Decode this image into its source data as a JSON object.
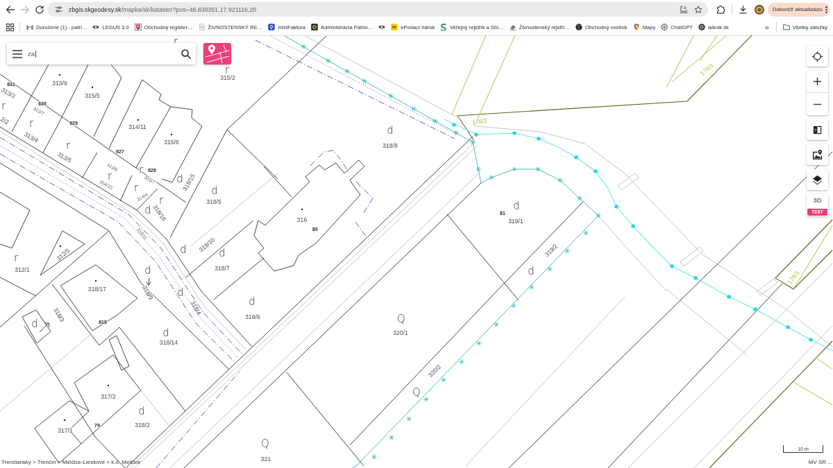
{
  "browser": {
    "navigation": [
      {
        "kind": "back",
        "disabled": false
      },
      {
        "kind": "forward",
        "disabled": true
      },
      {
        "kind": "reload",
        "disabled": false
      }
    ],
    "address": {
      "host": "zbgis.skgeodesy.sk",
      "path": "/mapka/sk/kataster?pos=48.838351,17.921116,20"
    },
    "update_button": "Dokončiť aktualizáciu"
  },
  "bookmarks": {
    "items": [
      {
        "kind": "mail",
        "label": "Doručené (1) - patri…"
      },
      {
        "kind": "eye",
        "label": "LEGUS 3.0"
      },
      {
        "kind": "emblem",
        "label": "Obchodný register…"
      },
      {
        "kind": "document",
        "label": "ŽIVNOSTENSKÝ RE…"
      },
      {
        "kind": "shield",
        "label": "miniFaktúra"
      },
      {
        "kind": "seal",
        "label": "Administrácia Patrio…"
      },
      {
        "kind": "eye"
      },
      {
        "kind": "tile",
        "label": "ePodací hárok"
      },
      {
        "kind": "letter",
        "label": "Veřejný rejstřík a Sbí…"
      },
      {
        "kind": "stamp",
        "label": "Živnostenský rejstří…"
      },
      {
        "kind": "globe",
        "label": "Obchodný vestník"
      },
      {
        "kind": "pin",
        "label": "Mapy"
      },
      {
        "kind": "knot",
        "label": "ChatGPT"
      },
      {
        "kind": "badge",
        "label": "advok.sk"
      }
    ],
    "overflow": "»",
    "all": "Všetky záložky"
  },
  "map": {
    "search": {
      "value": "za"
    },
    "labels": [
      {
        "kind": "symbol",
        "text": "r"
      },
      {
        "kind": "symbol",
        "text": "r"
      },
      {
        "kind": "secondary",
        "text": "176/3"
      },
      {
        "kind": "parcel",
        "text": "315/2"
      },
      {
        "kind": "building",
        "text": "631"
      },
      {
        "kind": "parcel",
        "text": "313/9"
      },
      {
        "kind": "parcel",
        "text": "313/3"
      },
      {
        "kind": "parcel",
        "text": "315/5"
      },
      {
        "kind": "symbol",
        "text": "r"
      },
      {
        "kind": "building",
        "text": "630"
      },
      {
        "kind": "minor",
        "text": "313/7"
      },
      {
        "kind": "parcel",
        "text": "2/2"
      },
      {
        "kind": "symbol",
        "text": "r"
      },
      {
        "kind": "building",
        "text": "629"
      },
      {
        "kind": "secondary",
        "text": "176/2"
      },
      {
        "kind": "parcel",
        "text": "314/11"
      },
      {
        "kind": "symbol",
        "text": "d"
      },
      {
        "kind": "parcel",
        "text": "313/4"
      },
      {
        "kind": "parcel",
        "text": "315/6"
      },
      {
        "kind": "symbol",
        "text": "r"
      },
      {
        "kind": "parcel",
        "text": "318/8"
      },
      {
        "kind": "building",
        "text": "627"
      },
      {
        "kind": "parcel",
        "text": "313/5"
      },
      {
        "kind": "minor",
        "text": "313/6"
      },
      {
        "kind": "symbol",
        "text": "r"
      },
      {
        "kind": "building",
        "text": "626"
      },
      {
        "kind": "symbol",
        "text": "r"
      },
      {
        "kind": "minor",
        "text": "315/7"
      },
      {
        "kind": "symbol",
        "text": "d"
      },
      {
        "kind": "minor",
        "text": "314/10"
      },
      {
        "kind": "parcel",
        "text": "318/15"
      },
      {
        "kind": "symbol",
        "text": "r"
      },
      {
        "kind": "symbol",
        "text": "d"
      },
      {
        "kind": "minor",
        "text": "314/4"
      },
      {
        "kind": "symbol",
        "text": "r"
      },
      {
        "kind": "parcel",
        "text": "318/5"
      },
      {
        "kind": "symbol",
        "text": "d"
      },
      {
        "kind": "symbol",
        "text": "d"
      },
      {
        "kind": "parcel",
        "text": "318/16"
      },
      {
        "kind": "building",
        "text": "81"
      },
      {
        "kind": "parcel",
        "text": "316"
      },
      {
        "kind": "parcel",
        "text": "319/1"
      },
      {
        "kind": "building",
        "text": "80"
      },
      {
        "kind": "minor",
        "text": "318/11"
      },
      {
        "kind": "parcel",
        "text": "318/10"
      },
      {
        "kind": "parcel",
        "text": "312/5"
      },
      {
        "kind": "symbol",
        "text": "d"
      },
      {
        "kind": "symbol",
        "text": "d"
      },
      {
        "kind": "parcel",
        "text": "319/2"
      },
      {
        "kind": "symbol",
        "text": "r"
      },
      {
        "kind": "parcel",
        "text": "312/1"
      },
      {
        "kind": "symbol",
        "text": "d"
      },
      {
        "kind": "parcel",
        "text": "318/7"
      },
      {
        "kind": "symbol",
        "text": "d"
      },
      {
        "kind": "secondary",
        "text": "176/1"
      },
      {
        "kind": "parcel",
        "text": "318/17"
      },
      {
        "kind": "parcel",
        "text": "318/9"
      },
      {
        "kind": "symbol",
        "text": "d"
      },
      {
        "kind": "symbol",
        "text": "d"
      },
      {
        "kind": "parcel",
        "text": "318/4"
      },
      {
        "kind": "parcel",
        "text": "318/3"
      },
      {
        "kind": "parcel",
        "text": "318/6"
      },
      {
        "kind": "symbol",
        "text": "Q"
      },
      {
        "kind": "symbol",
        "text": "d"
      },
      {
        "kind": "building",
        "text": "618"
      },
      {
        "kind": "symbol",
        "text": "d"
      },
      {
        "kind": "parcel",
        "text": "320/1"
      },
      {
        "kind": "parcel",
        "text": "318/14"
      },
      {
        "kind": "parcel",
        "text": "320/2"
      },
      {
        "kind": "symbol",
        "text": "Q"
      },
      {
        "kind": "parcel",
        "text": "317/2"
      },
      {
        "kind": "symbol",
        "text": "d"
      },
      {
        "kind": "building",
        "text": "79"
      },
      {
        "kind": "parcel",
        "text": "318/2"
      },
      {
        "kind": "parcel",
        "text": "317/1"
      },
      {
        "kind": "symbol",
        "text": "Q"
      },
      {
        "kind": "parcel",
        "text": "321"
      }
    ],
    "controls": {
      "view_3d": "3D",
      "badge": "TEST"
    },
    "breadcrumb": "Trenčiansky > Trenčín > Melčice-Lieskové > k.ú. Melčice",
    "scale": "10 m",
    "attribution": "MV SR ..."
  }
}
